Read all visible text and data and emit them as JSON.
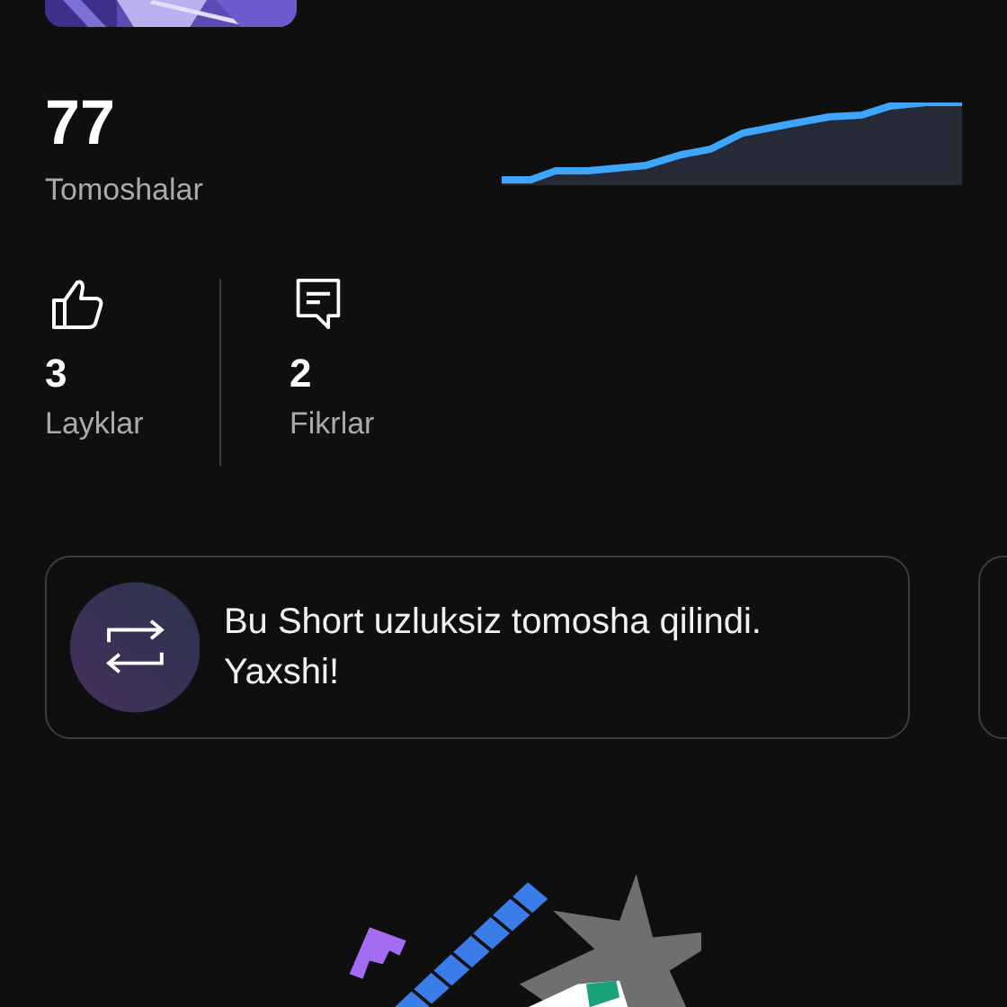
{
  "views": {
    "value": "77",
    "label": "Tomoshalar"
  },
  "stats": [
    {
      "kind": "likes",
      "value": "3",
      "label": "Layklar"
    },
    {
      "kind": "comments",
      "value": "2",
      "label": "Fikrlar"
    }
  ],
  "insight": {
    "text": "Bu Short uzluksiz tomosha qilindi. Yaxshi!"
  }
}
